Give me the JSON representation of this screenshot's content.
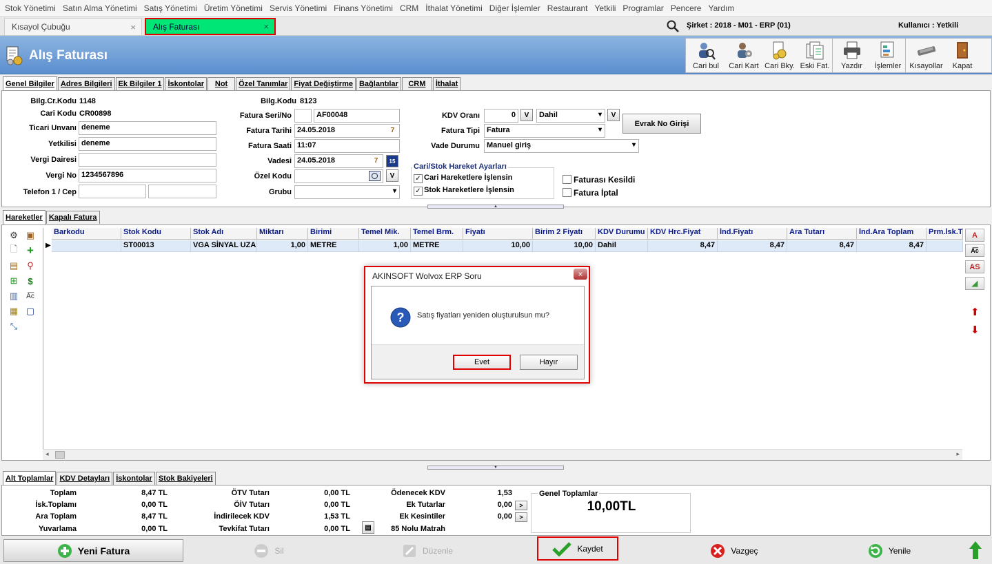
{
  "menu": [
    "Stok Yönetimi",
    "Satın Alma Yönetimi",
    "Satış Yönetimi",
    "Üretim Yönetimi",
    "Servis Yönetimi",
    "Finans Yönetimi",
    "CRM",
    "İthalat Yönetimi",
    "Diğer İşlemler",
    "Restaurant",
    "Yetkili",
    "Programlar",
    "Pencere",
    "Yardım"
  ],
  "tabs": {
    "shortcut": "Kısayol Çubuğu",
    "active": "Alış Faturası",
    "close": "×"
  },
  "header": {
    "company": "Şirket : 2018 - M01 - ERP (01)",
    "user": "Kullanıcı : Yetkili"
  },
  "page_title": "Alış Faturası",
  "toolbar": [
    "Cari bul",
    "Cari Kart",
    "Cari Bky.",
    "Eski Fat.",
    "Yazdır",
    "İşlemler",
    "Kısayollar",
    "Kapat"
  ],
  "form_tabs": [
    "Genel Bilgiler",
    "Adres Bilgileri",
    "Ek Bilgiler 1",
    "İskontolar",
    "Not",
    "Özel Tanımlar",
    "Fiyat Değiştirme",
    "Bağlantılar",
    "CRM",
    "İthalat"
  ],
  "form": {
    "bilg_cr_kodu_label": "Bilg.Cr.Kodu",
    "bilg_cr_kodu": "1148",
    "cari_kodu_label": "Cari Kodu",
    "cari_kodu": "CR00898",
    "ticari_unvani_label": "Ticari Unvanı",
    "ticari_unvani": "deneme",
    "yetkilisi_label": "Yetkilisi",
    "yetkilisi": "deneme",
    "vergi_dairesi_label": "Vergi Dairesi",
    "vergi_dairesi": "",
    "vergi_no_label": "Vergi No",
    "vergi_no": "1234567896",
    "telefon_label": "Telefon 1 / Cep",
    "bilg_kodu_label": "Bilg.Kodu",
    "bilg_kodu": "8123",
    "fatura_seri_label": "Fatura Seri/No",
    "fatura_seri": "",
    "fatura_no": "AF00048",
    "fatura_tarihi_label": "Fatura Tarihi",
    "fatura_tarihi": "24.05.2018",
    "fatura_saati_label": "Fatura Saati",
    "fatura_saati": "11:07",
    "vadesi_label": "Vadesi",
    "vadesi": "24.05.2018",
    "ozel_kodu_label": "Özel Kodu",
    "ozel_kodu": "",
    "grubu_label": "Grubu",
    "grubu": "",
    "kdv_orani_label": "KDV Oranı",
    "kdv_orani": "0",
    "kdv_dahil": "Dahil",
    "fatura_tipi_label": "Fatura Tipi",
    "fatura_tipi": "Fatura",
    "vade_durumu_label": "Vade Durumu",
    "vade_durumu": "Manuel giriş",
    "evrak_button": "Evrak No Girişi",
    "v_label": "V",
    "calendar_day": "7",
    "calendar_num": "15",
    "group_title": "Cari/Stok Hareket Ayarları",
    "cari_hareket": "Cari Hareketlere İşlensin",
    "stok_hareket": "Stok Hareketlere İşlensin",
    "faturasi_kesildi": "Faturası Kesildi",
    "fatura_iptal": "Fatura İptal"
  },
  "hareket_tabs": [
    "Hareketler",
    "Kapalı Fatura"
  ],
  "grid": {
    "columns": [
      "Barkodu",
      "Stok Kodu",
      "Stok Adı",
      "Miktarı",
      "Birimi",
      "Temel Mik.",
      "Temel Brm.",
      "Fiyatı",
      "Birim 2 Fiyatı",
      "KDV Durumu",
      "KDV Hrc.Fiyat",
      "İnd.Fiyatı",
      "Ara Tutarı",
      "İnd.Ara Toplam",
      "Prm.İsk.T"
    ],
    "rows": [
      [
        "",
        "ST00013",
        "VGA SİNYAL UZA",
        "1,00",
        "METRE",
        "1,00",
        "METRE",
        "10,00",
        "10,00",
        "Dahil",
        "8,47",
        "8,47",
        "8,47",
        "8,47",
        ""
      ]
    ]
  },
  "right_buttons": [
    "A",
    "AS"
  ],
  "bottom_tabs": [
    "Alt Toplamlar",
    "KDV Detayları",
    "İskontolar",
    "Stok Bakiyeleri"
  ],
  "totals": {
    "toplam_label": "Toplam",
    "toplam": "8,47 TL",
    "isk_label": "İsk.Toplamı",
    "isk": "0,00 TL",
    "ara_label": "Ara Toplam",
    "ara": "8,47 TL",
    "yuv_label": "Yuvarlama",
    "yuv": "0,00 TL",
    "otv_label": "ÖTV Tutarı",
    "otv": "0,00 TL",
    "oiv_label": "ÖİV Tutarı",
    "oiv": "0,00 TL",
    "ind_kdv_label": "İndirilecek KDV",
    "ind_kdv": "1,53 TL",
    "tevkifat_label": "Tevkifat Tutarı",
    "tevkifat": "0,00 TL",
    "odenecek_label": "Ödenecek KDV",
    "odenecek": "1,53",
    "ek_tutar_label": "Ek Tutarlar",
    "ek_tutar": "0,00",
    "ek_kesinti_label": "Ek Kesintiler",
    "ek_kesinti": "0,00",
    "matrah_label": "85 Nolu Matrah",
    "gt_label": "Genel Toplamlar",
    "gt": "10,00TL"
  },
  "bottom_buttons": {
    "new": "Yeni Fatura",
    "delete": "Sil",
    "edit": "Düzenle",
    "save": "Kaydet",
    "cancel": "Vazgeç",
    "refresh": "Yenile"
  },
  "dialog": {
    "title": "AKINSOFT Wolvox ERP Soru",
    "close": "×",
    "message": "Satış fiyatları yeniden oluşturulsun mu?",
    "yes": "Evet",
    "no": "Hayır"
  },
  "colors": {
    "active_tab": "#00e676",
    "highlight": "#e00000",
    "title_bar": "#5b8ecf",
    "header_text": "#0a1a8a"
  }
}
